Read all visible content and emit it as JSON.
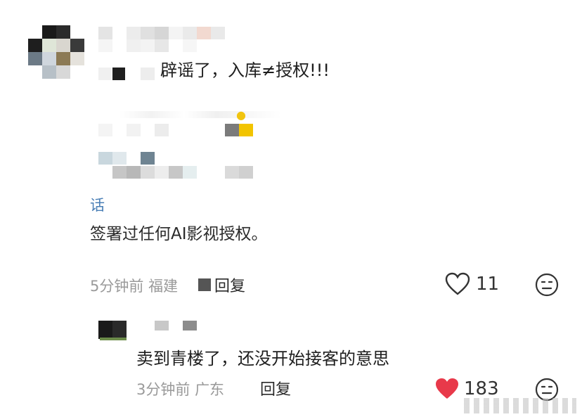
{
  "comment_main": {
    "text": "辟谣了，入库≠授权!!!",
    "quoted_name": "话",
    "quoted_text": "签署过任何AI影视授权。",
    "time": "5分钟前",
    "location": "福建",
    "reply_label": "回复",
    "like_count": "11",
    "liked": false,
    "icons": [
      "heart-outline-icon",
      "dislike-face-icon"
    ]
  },
  "reply_comment": {
    "text": "卖到青楼了，还没开始接客的意思",
    "time": "3分钟前",
    "location": "广东",
    "reply_label": "回复",
    "like_count": "183",
    "liked": true,
    "icons": [
      "heart-filled-icon",
      "dislike-face-icon"
    ]
  },
  "colors": {
    "like_active": "#e8394a",
    "meta_gray": "#9a9a9a",
    "text": "#1e1e1e",
    "watermark": "#bdbdbd"
  }
}
